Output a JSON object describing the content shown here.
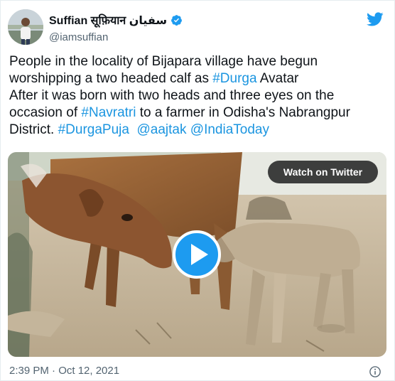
{
  "author": {
    "display_name": "Suffian सूफ़ियान سفیان",
    "handle": "@iamsuffian",
    "verified": true,
    "avatar_icon": "avatar-photo",
    "verified_icon": "verified-badge-icon"
  },
  "platform_icon": "twitter-bird-icon",
  "tweet": {
    "lines": [
      [
        {
          "text": "People in the locality of Bijapara village have begun",
          "link": false
        }
      ],
      [
        {
          "text": "worshipping a two headed calf as ",
          "link": false
        },
        {
          "text": "#Durga",
          "link": true
        },
        {
          "text": " Avatar",
          "link": false
        }
      ],
      [
        {
          "text": "After it was born with two heads and three eyes on the",
          "link": false
        }
      ],
      [
        {
          "text": "occasion of ",
          "link": false
        },
        {
          "text": "#Navratri",
          "link": true
        },
        {
          "text": " to a farmer in Odisha's Nabrangpur",
          "link": false
        }
      ],
      [
        {
          "text": "District. ",
          "link": false
        },
        {
          "text": "#DurgaPuja",
          "link": true
        },
        {
          "text": "  ",
          "link": false
        },
        {
          "text": "@aajtak",
          "link": true
        },
        {
          "text": " ",
          "link": false
        },
        {
          "text": "@IndiaToday",
          "link": true
        }
      ]
    ]
  },
  "media": {
    "watch_button_label": "Watch on Twitter",
    "play_icon": "play-icon",
    "description_icon": "video-thumbnail-cow-and-calf"
  },
  "footer": {
    "timestamp": "2:39 PM · Oct 12, 2021",
    "info_icon": "info-icon"
  },
  "colors": {
    "link": "#1b95e0",
    "play_button": "#1d9bf0",
    "twitter_blue": "#1d9bf0",
    "secondary_text": "#536471"
  }
}
